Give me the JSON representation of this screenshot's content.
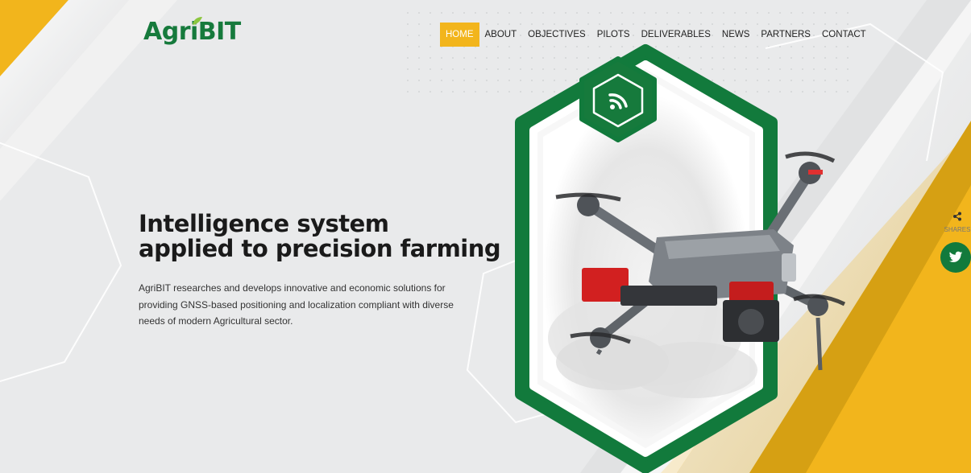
{
  "brand": {
    "logo_text": "AgriBIT"
  },
  "nav": {
    "items": [
      {
        "label": "HOME",
        "active": true
      },
      {
        "label": "ABOUT"
      },
      {
        "label": "OBJECTIVES"
      },
      {
        "label": "PILOTS"
      },
      {
        "label": "DELIVERABLES"
      },
      {
        "label": "NEWS"
      },
      {
        "label": "PARTNERS"
      },
      {
        "label": "CONTACT"
      }
    ]
  },
  "hero": {
    "title_line1": "Intelligence system",
    "title_line2": "applied to precision farming",
    "description": "AgriBIT researches and develops innovative and economic solutions for providing GNSS-based positioning and localization compliant with diverse needs of modern Agricultural sector."
  },
  "share": {
    "label": "SHARES",
    "icon": "share-icon",
    "social_icon": "twitter-icon"
  },
  "colors": {
    "accent_yellow": "#f2b51c",
    "brand_green": "#127a3c",
    "background": "#e9eaeb"
  }
}
